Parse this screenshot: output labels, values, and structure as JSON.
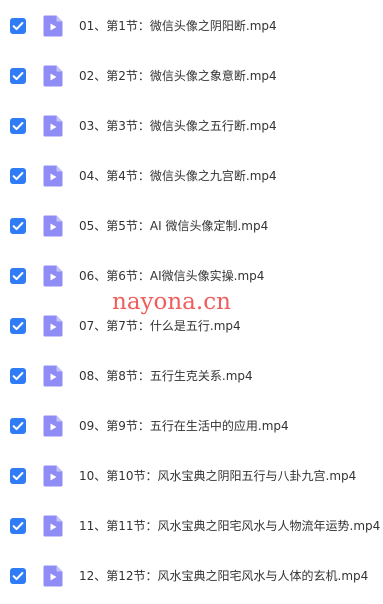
{
  "files": [
    {
      "checked": true,
      "name": "01、第1节：微信头像之阴阳断.mp4"
    },
    {
      "checked": true,
      "name": "02、第2节：微信头像之象意断.mp4"
    },
    {
      "checked": true,
      "name": "03、第3节：微信头像之五行断.mp4"
    },
    {
      "checked": true,
      "name": "04、第4节：微信头像之九宫断.mp4"
    },
    {
      "checked": true,
      "name": "05、第5节：AI 微信头像定制.mp4"
    },
    {
      "checked": true,
      "name": "06、第6节：AI微信头像实操.mp4"
    },
    {
      "checked": true,
      "name": "07、第7节：什么是五行.mp4"
    },
    {
      "checked": true,
      "name": "08、第8节：五行生克关系.mp4"
    },
    {
      "checked": true,
      "name": "09、第9节：五行在生活中的应用.mp4"
    },
    {
      "checked": true,
      "name": "10、第10节：风水宝典之阴阳五行与八卦九宫.mp4"
    },
    {
      "checked": true,
      "name": "11、第11节：风水宝典之阳宅风水与人物流年运势.mp4"
    },
    {
      "checked": true,
      "name": "12、第12节：风水宝典之阳宅风水与人体的玄机.mp4"
    }
  ],
  "watermark": "nayona.cn",
  "colors": {
    "checkbox": "#2f7cf6",
    "file_icon": "#8f8cf5",
    "file_icon_fold": "#c4c2fa",
    "text": "#333333",
    "watermark": "#ec3a3a"
  },
  "icons": {
    "checkbox": "checkmark-icon",
    "file": "video-file-icon"
  }
}
